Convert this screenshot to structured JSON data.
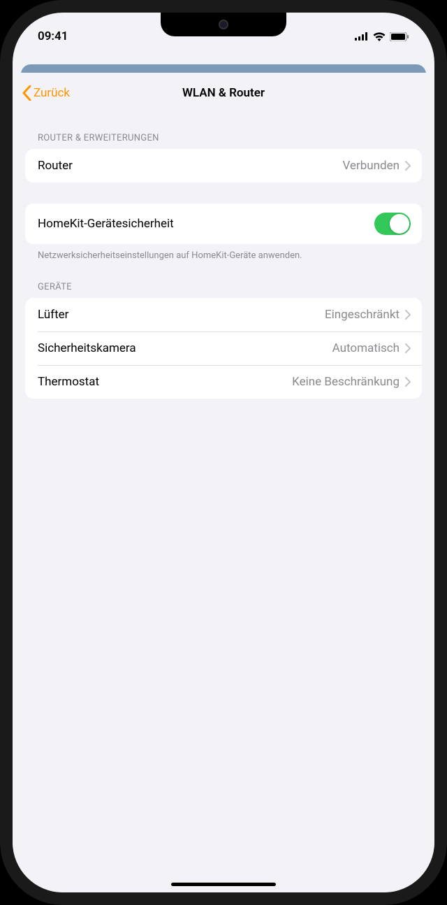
{
  "status": {
    "time": "09:41"
  },
  "nav": {
    "back_label": "Zurück",
    "title": "WLAN & Router"
  },
  "sections": {
    "router_ext_header": "ROUTER & ERWEITERUNGEN",
    "devices_header": "GERÄTE"
  },
  "router_row": {
    "label": "Router",
    "value": "Verbunden"
  },
  "security_row": {
    "label": "HomeKit-Gerätesicherheit",
    "footer": "Netzwerksicherheitseinstellungen auf HomeKit-Geräte anwenden.",
    "toggle_on": true
  },
  "devices": [
    {
      "label": "Lüfter",
      "value": "Eingeschränkt"
    },
    {
      "label": "Sicherheitskamera",
      "value": "Automatisch"
    },
    {
      "label": "Thermostat",
      "value": "Keine Beschränkung"
    }
  ]
}
